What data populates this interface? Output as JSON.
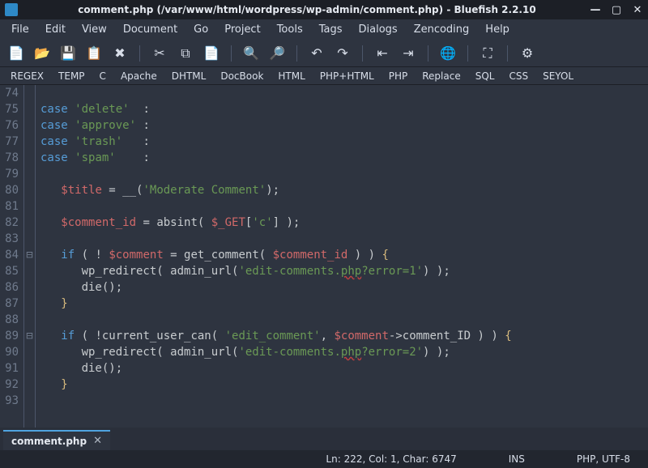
{
  "window": {
    "title": "comment.php (/var/www/html/wordpress/wp-admin/comment.php) - Bluefish 2.2.10"
  },
  "menu": {
    "items": [
      "File",
      "Edit",
      "View",
      "Document",
      "Go",
      "Project",
      "Tools",
      "Tags",
      "Dialogs",
      "Zencoding",
      "Help"
    ]
  },
  "toolbar": {
    "buttons": [
      {
        "name": "new-file-icon",
        "glyph": "📄"
      },
      {
        "name": "open-file-icon",
        "glyph": "📂"
      },
      {
        "name": "save-icon",
        "glyph": "💾"
      },
      {
        "name": "save-as-icon",
        "glyph": "📋"
      },
      {
        "name": "close-file-icon",
        "glyph": "✖"
      },
      {
        "sep": true
      },
      {
        "name": "cut-icon",
        "glyph": "✂"
      },
      {
        "name": "copy-icon",
        "glyph": "⧉"
      },
      {
        "name": "paste-icon",
        "glyph": "📄"
      },
      {
        "sep": true
      },
      {
        "name": "search-icon",
        "glyph": "🔍"
      },
      {
        "name": "search-replace-icon",
        "glyph": "🔎"
      },
      {
        "sep": true
      },
      {
        "name": "undo-icon",
        "glyph": "↶"
      },
      {
        "name": "redo-icon",
        "glyph": "↷"
      },
      {
        "sep": true
      },
      {
        "name": "unindent-icon",
        "glyph": "⇤"
      },
      {
        "name": "indent-icon",
        "glyph": "⇥"
      },
      {
        "sep": true
      },
      {
        "name": "browser-preview-icon",
        "glyph": "🌐"
      },
      {
        "sep": true
      },
      {
        "name": "fullscreen-icon",
        "glyph": "⛶"
      },
      {
        "sep": true
      },
      {
        "name": "preferences-icon",
        "glyph": "⚙"
      }
    ]
  },
  "quickbar": {
    "items": [
      "REGEX",
      "TEMP",
      "C",
      "Apache",
      "DHTML",
      "DocBook",
      "HTML",
      "PHP+HTML",
      "PHP",
      "Replace",
      "SQL",
      "CSS",
      "SEYOL"
    ]
  },
  "editor": {
    "first_line": 74,
    "lines": [
      {
        "n": 74,
        "fold": "",
        "tokens": []
      },
      {
        "n": 75,
        "fold": "",
        "tokens": [
          [
            "kw",
            "case "
          ],
          [
            "str",
            "'delete'"
          ],
          [
            "punc",
            "  :"
          ]
        ]
      },
      {
        "n": 76,
        "fold": "",
        "tokens": [
          [
            "kw",
            "case "
          ],
          [
            "str",
            "'approve'"
          ],
          [
            "punc",
            " :"
          ]
        ]
      },
      {
        "n": 77,
        "fold": "",
        "tokens": [
          [
            "kw",
            "case "
          ],
          [
            "str",
            "'trash'"
          ],
          [
            "punc",
            "   :"
          ]
        ]
      },
      {
        "n": 78,
        "fold": "",
        "tokens": [
          [
            "kw",
            "case "
          ],
          [
            "str",
            "'spam'"
          ],
          [
            "punc",
            "    :"
          ]
        ]
      },
      {
        "n": 79,
        "fold": "",
        "tokens": []
      },
      {
        "n": 80,
        "fold": "",
        "tokens": [
          [
            "punc",
            "   "
          ],
          [
            "var",
            "$title"
          ],
          [
            "punc",
            " = "
          ],
          [
            "func",
            "__"
          ],
          [
            "punc",
            "("
          ],
          [
            "str",
            "'Moderate Comment'"
          ],
          [
            "punc",
            ");"
          ]
        ]
      },
      {
        "n": 81,
        "fold": "",
        "tokens": []
      },
      {
        "n": 82,
        "fold": "",
        "tokens": [
          [
            "punc",
            "   "
          ],
          [
            "var",
            "$comment_id"
          ],
          [
            "punc",
            " = "
          ],
          [
            "func",
            "absint"
          ],
          [
            "punc",
            "( "
          ],
          [
            "var",
            "$_GET"
          ],
          [
            "punc",
            "["
          ],
          [
            "str",
            "'c'"
          ],
          [
            "punc",
            "] );"
          ]
        ]
      },
      {
        "n": 83,
        "fold": "",
        "tokens": []
      },
      {
        "n": 84,
        "fold": "⊟",
        "tokens": [
          [
            "punc",
            "   "
          ],
          [
            "kw",
            "if"
          ],
          [
            "punc",
            " ( ! "
          ],
          [
            "var",
            "$comment"
          ],
          [
            "punc",
            " = "
          ],
          [
            "func",
            "get_comment"
          ],
          [
            "punc",
            "( "
          ],
          [
            "var",
            "$comment_id"
          ],
          [
            "punc",
            " ) ) "
          ],
          [
            "brace",
            "{"
          ]
        ]
      },
      {
        "n": 85,
        "fold": "",
        "tokens": [
          [
            "punc",
            "      "
          ],
          [
            "func",
            "wp_redirect"
          ],
          [
            "punc",
            "( "
          ],
          [
            "func",
            "admin_url"
          ],
          [
            "punc",
            "("
          ],
          [
            "str",
            "'edit-comments."
          ],
          [
            "str underline",
            "php"
          ],
          [
            "str",
            "?error=1'"
          ],
          [
            "punc",
            ") );"
          ]
        ]
      },
      {
        "n": 86,
        "fold": "",
        "tokens": [
          [
            "punc",
            "      "
          ],
          [
            "func",
            "die"
          ],
          [
            "punc",
            "();"
          ]
        ]
      },
      {
        "n": 87,
        "fold": "",
        "tokens": [
          [
            "punc",
            "   "
          ],
          [
            "brace",
            "}"
          ]
        ]
      },
      {
        "n": 88,
        "fold": "",
        "tokens": []
      },
      {
        "n": 89,
        "fold": "⊟",
        "tokens": [
          [
            "punc",
            "   "
          ],
          [
            "kw",
            "if"
          ],
          [
            "punc",
            " ( !"
          ],
          [
            "func",
            "current_user_can"
          ],
          [
            "punc",
            "( "
          ],
          [
            "str",
            "'edit_comment'"
          ],
          [
            "punc",
            ", "
          ],
          [
            "var",
            "$comment"
          ],
          [
            "arrow",
            "->"
          ],
          [
            "func",
            "comment_ID"
          ],
          [
            "punc",
            " ) ) "
          ],
          [
            "brace",
            "{"
          ]
        ]
      },
      {
        "n": 90,
        "fold": "",
        "tokens": [
          [
            "punc",
            "      "
          ],
          [
            "func",
            "wp_redirect"
          ],
          [
            "punc",
            "( "
          ],
          [
            "func",
            "admin_url"
          ],
          [
            "punc",
            "("
          ],
          [
            "str",
            "'edit-comments."
          ],
          [
            "str underline",
            "php"
          ],
          [
            "str",
            "?error=2'"
          ],
          [
            "punc",
            ") );"
          ]
        ]
      },
      {
        "n": 91,
        "fold": "",
        "tokens": [
          [
            "punc",
            "      "
          ],
          [
            "func",
            "die"
          ],
          [
            "punc",
            "();"
          ]
        ]
      },
      {
        "n": 92,
        "fold": "",
        "tokens": [
          [
            "punc",
            "   "
          ],
          [
            "brace",
            "}"
          ]
        ]
      },
      {
        "n": 93,
        "fold": "",
        "tokens": []
      }
    ]
  },
  "tabs": {
    "items": [
      {
        "label": "comment.php",
        "active": true
      }
    ]
  },
  "status": {
    "position": "Ln: 222, Col: 1, Char: 6747",
    "insert_mode": "INS",
    "encoding": "PHP, UTF-8"
  }
}
